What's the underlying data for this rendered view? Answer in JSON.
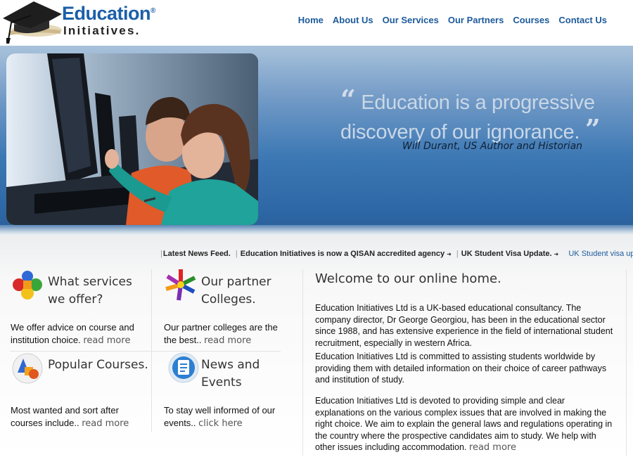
{
  "header": {
    "logo_word1": "Education",
    "logo_reg": "®",
    "logo_word2": "Initiatives.",
    "nav": [
      "Home",
      "About Us",
      "Our Services",
      "Our Partners",
      "Courses",
      "Contact Us"
    ]
  },
  "hero": {
    "quote_open": "“",
    "quote_text1": "Education is a progressive",
    "quote_text2": "discovery of our ignorance.",
    "quote_close": "”",
    "quote_author": "Will Durant, US Author and Historian"
  },
  "ticker": {
    "lead": "Latest News Feed.",
    "item1": "Education Initiatives is now a QISAN accredited agency",
    "item2": "UK Student Visa Update.",
    "item3": "UK Student visa update: Visit:"
  },
  "boxes": {
    "services": {
      "title1": "What services",
      "title2": "we offer?",
      "text1": "We offer advice on course and",
      "text2": "institution choice.",
      "more": "read more"
    },
    "partners": {
      "title1": "Our partner",
      "title2": "Colleges.",
      "text1": "Our partner colleges are the",
      "text2": "the best..",
      "more": "read more"
    },
    "courses": {
      "title1": "Popular Courses.",
      "text1": "Most wanted and sort after",
      "text2": "courses include..",
      "more": "read more"
    },
    "news": {
      "title1": "News and",
      "title2": "Events",
      "text1": "To stay well informed of our",
      "text2": "events..",
      "more": "click here"
    }
  },
  "welcome": {
    "title": "Welcome to our online home.",
    "p1": "Education Initiatives Ltd is a UK-based educational consultancy. The company director, Dr George Georgiou, has been in the educational sector since 1988, and has extensive experience in the field of international student recruitment, especially in western Africa.",
    "p2": "Education Initiatives Ltd is committed to assisting students worldwide by providing them with detailed information on their choice of career pathways and institution of study.",
    "p3": "Education Initiatives Ltd is devoted to providing simple and clear explanations on the various complex issues that are involved in making the right choice. We aim to explain the general laws and regulations operating in the country where the prospective candidates aim to study. We help with other issues including accommodation.",
    "p3_more": "read more"
  },
  "colors": {
    "brand_blue": "#1b5fa8",
    "nav_blue": "#1d5a9b",
    "hero_blue": "#2d66a4"
  },
  "icons": [
    "graduation-cap-icon",
    "puzzle-icon",
    "arrows-icon",
    "shapes-icon",
    "document-icon"
  ]
}
